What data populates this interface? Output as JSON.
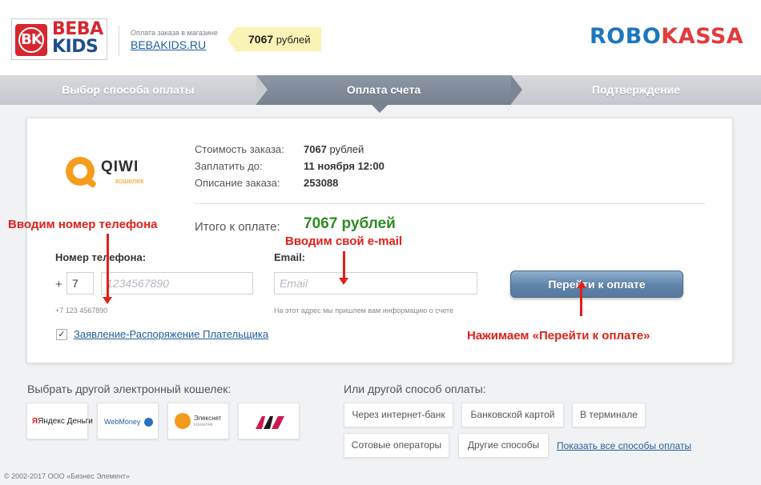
{
  "header": {
    "logo_top": "BEBA",
    "logo_bottom": "KIDS",
    "logo_mark": "BK",
    "shop_caption": "Оплата заказа в магазине",
    "shop_link": "BEBAKIDS.RU",
    "price_amount": "7067",
    "price_currency": "рублей",
    "brand_robo": "ROBO",
    "brand_kassa": "KASSA"
  },
  "steps": [
    {
      "label": "Выбор способа оплаты",
      "state": "done"
    },
    {
      "label": "Оплата счета",
      "state": "active"
    },
    {
      "label": "Подтверждение",
      "state": "pending"
    }
  ],
  "payment_method": {
    "logo_word": "QIWI",
    "logo_sub": "кошелек",
    "icon": "qiwi-logo-icon",
    "brand_color": "#f59c1a"
  },
  "order": {
    "cost_label": "Стоимость заказа:",
    "cost_amount": "7067",
    "cost_currency": "рублей",
    "pay_until_label": "Заплатить до:",
    "pay_until_value": "11 ноября 12:00",
    "description_label": "Описание заказа:",
    "description_value": "253088",
    "total_label": "Итого к оплате:",
    "total_value": "7067 рублей",
    "total_color": "#2e8a23"
  },
  "form": {
    "phone_label": "Номер телефона:",
    "plus_sign": "+",
    "country_code_value": "7",
    "phone_placeholder": "1234567890",
    "phone_hint": "+7 123 4567890",
    "email_label": "Email:",
    "email_placeholder": "Email",
    "email_hint": "На этот адрес мы пришлем вам информацию о счете",
    "submit_label": "Перейти к оплате",
    "agreement_checked": true,
    "agreement_mark": "✓",
    "agreement_link": "Заявление-Распоряжение Плательщика"
  },
  "annotations": {
    "phone_note": "Вводим номер телефона",
    "email_note": "Вводим свой e-mail",
    "button_note": "Нажимаем «Перейти к оплате»",
    "color": "#e0201a"
  },
  "other_wallets": {
    "title": "Выбрать другой электронный кошелек:",
    "items": [
      {
        "name": "Яндекс Деньги",
        "icon": "yandex-money-icon"
      },
      {
        "name": "WebMoney",
        "icon": "webmoney-icon"
      },
      {
        "name": "Элекснет",
        "sub": "кошелек",
        "icon": "eleksnet-icon"
      },
      {
        "name": "",
        "icon": "mts-money-icon"
      }
    ]
  },
  "other_methods": {
    "title": "Или другой способ оплаты:",
    "buttons": [
      "Через интернет-банк",
      "Банковской картой",
      "В терминале",
      "Сотовые операторы",
      "Другие способы"
    ],
    "show_all": "Показать все способы оплаты"
  },
  "footer": {
    "copyright": "© 2002-2017 ООО «Бизнес Элемент»"
  }
}
